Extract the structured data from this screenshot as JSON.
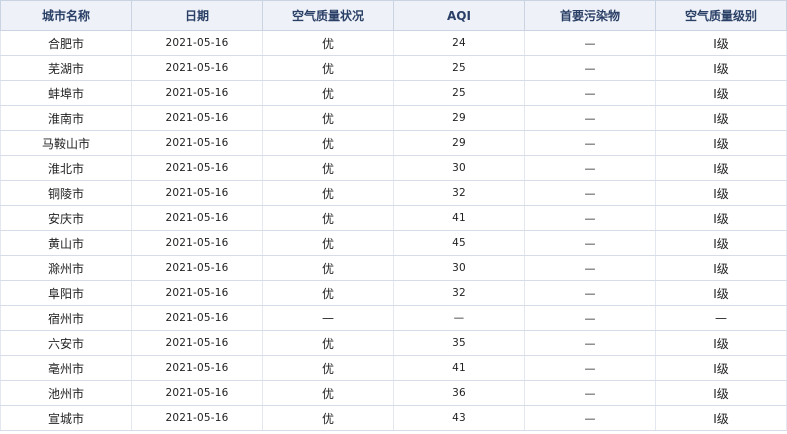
{
  "headers": {
    "city": "城市名称",
    "date": "日期",
    "status": "空气质量状况",
    "aqi": "AQI",
    "pollutant": "首要污染物",
    "level": "空气质量级别"
  },
  "rows": [
    {
      "city": "合肥市",
      "date": "2021-05-16",
      "status": "优",
      "aqi": "24",
      "pollutant": "—",
      "level": "Ⅰ级"
    },
    {
      "city": "芜湖市",
      "date": "2021-05-16",
      "status": "优",
      "aqi": "25",
      "pollutant": "—",
      "level": "Ⅰ级"
    },
    {
      "city": "蚌埠市",
      "date": "2021-05-16",
      "status": "优",
      "aqi": "25",
      "pollutant": "—",
      "level": "Ⅰ级"
    },
    {
      "city": "淮南市",
      "date": "2021-05-16",
      "status": "优",
      "aqi": "29",
      "pollutant": "—",
      "level": "Ⅰ级"
    },
    {
      "city": "马鞍山市",
      "date": "2021-05-16",
      "status": "优",
      "aqi": "29",
      "pollutant": "—",
      "level": "Ⅰ级"
    },
    {
      "city": "淮北市",
      "date": "2021-05-16",
      "status": "优",
      "aqi": "30",
      "pollutant": "—",
      "level": "Ⅰ级"
    },
    {
      "city": "铜陵市",
      "date": "2021-05-16",
      "status": "优",
      "aqi": "32",
      "pollutant": "—",
      "level": "Ⅰ级"
    },
    {
      "city": "安庆市",
      "date": "2021-05-16",
      "status": "优",
      "aqi": "41",
      "pollutant": "—",
      "level": "Ⅰ级"
    },
    {
      "city": "黄山市",
      "date": "2021-05-16",
      "status": "优",
      "aqi": "45",
      "pollutant": "—",
      "level": "Ⅰ级"
    },
    {
      "city": "滁州市",
      "date": "2021-05-16",
      "status": "优",
      "aqi": "30",
      "pollutant": "—",
      "level": "Ⅰ级"
    },
    {
      "city": "阜阳市",
      "date": "2021-05-16",
      "status": "优",
      "aqi": "32",
      "pollutant": "—",
      "level": "Ⅰ级"
    },
    {
      "city": "宿州市",
      "date": "2021-05-16",
      "status": "—",
      "aqi": "—",
      "pollutant": "—",
      "level": "—"
    },
    {
      "city": "六安市",
      "date": "2021-05-16",
      "status": "优",
      "aqi": "35",
      "pollutant": "—",
      "level": "Ⅰ级"
    },
    {
      "city": "亳州市",
      "date": "2021-05-16",
      "status": "优",
      "aqi": "41",
      "pollutant": "—",
      "level": "Ⅰ级"
    },
    {
      "city": "池州市",
      "date": "2021-05-16",
      "status": "优",
      "aqi": "36",
      "pollutant": "—",
      "level": "Ⅰ级"
    },
    {
      "city": "宣城市",
      "date": "2021-05-16",
      "status": "优",
      "aqi": "43",
      "pollutant": "—",
      "level": "Ⅰ级"
    }
  ],
  "colors": {
    "header_bg": "#eef2f8",
    "header_text": "#2a3f66",
    "border": "#d6dde8"
  }
}
